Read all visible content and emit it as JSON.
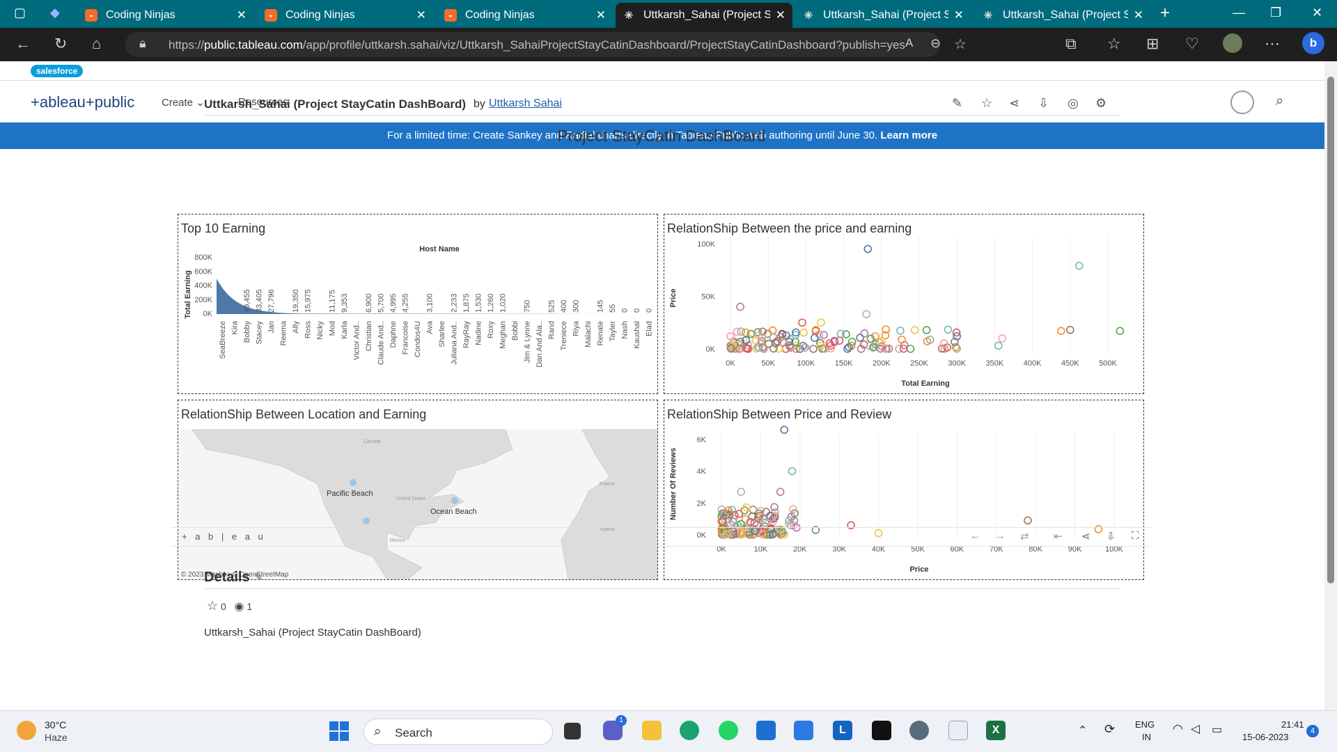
{
  "browser": {
    "tabs": [
      {
        "title": "Coding Ninjas",
        "icon": "coding-ninjas-icon",
        "active": false
      },
      {
        "title": "Coding Ninjas",
        "icon": "coding-ninjas-icon",
        "active": false
      },
      {
        "title": "Coding Ninjas",
        "icon": "coding-ninjas-icon",
        "active": false
      },
      {
        "title": "Uttkarsh_Sahai (Project Sta",
        "icon": "tableau-icon",
        "active": true
      },
      {
        "title": "Uttkarsh_Sahai (Project Sta",
        "icon": "tableau-icon",
        "active": false
      },
      {
        "title": "Uttkarsh_Sahai (Project Sta",
        "icon": "tableau-icon",
        "active": false
      }
    ],
    "url_prefix": "https://",
    "url_host": "public.tableau.com",
    "url_path": "/app/profile/uttkarsh.sahai/viz/Uttkarsh_SahaiProjectStayCatinDashboard/ProjectStayCatinDashboard?publish=yes"
  },
  "site": {
    "salesforce_label": "salesforce",
    "logo": "+ableau+public",
    "nav": {
      "create": "Create",
      "resources": "Resources"
    },
    "banner_text": "For a limited time: Create Sankey and Radial charts directly in Tableau Public web authoring until June 30.",
    "banner_link": "Learn more"
  },
  "viz": {
    "title": "Uttkarsh_Sahai (Project StayCatin DashBoard)",
    "by": "by",
    "author": "Uttkarsh Sahai",
    "dashboard_title": "Project StayCatin DashBoard",
    "wordmark": "+ a b | e a u"
  },
  "panels": {
    "top10": "Top 10 Earning",
    "price_earning": "RelationShip Between the price and earning",
    "location": "RelationShip Between Location and Earning",
    "price_review": "RelationShip Between Price and Review"
  },
  "map": {
    "labels": [
      "Pacific Beach",
      "Ocean Beach"
    ],
    "copyright": "© 2023 Mapbox  © OpenStreetMap",
    "faint": [
      "Canada",
      "United States",
      "Mexico",
      "France",
      "Algeria"
    ]
  },
  "chart_data": [
    {
      "type": "bar",
      "title": "Top 10 Earning",
      "xlabel": "Host Name",
      "ylabel": "Total Earning",
      "ylim": [
        0,
        800000
      ],
      "yticks": [
        "0K",
        "200K",
        "400K",
        "600K",
        "800K"
      ],
      "categories": [
        "SeaBreeze",
        "Kira",
        "Bobby",
        "Stacey",
        "Jan",
        "Reema",
        "Ally",
        "Ross",
        "Nicky",
        "Mod",
        "Karla",
        "Victor And..",
        "Christian",
        "Claude And..",
        "Daphne",
        "Francoise",
        "Condos4U",
        "Ava",
        "Sharlee",
        "Juliana And..",
        "RayRay",
        "Nadine",
        "Roxy",
        "Meghan",
        "Bobbi",
        "Jim & Lynne",
        "Dan And Ala..",
        "Rand",
        "Treniece",
        "Riya",
        "Malachi",
        "Renate",
        "Tayler",
        "Nash",
        "Kaushal",
        "Elad"
      ],
      "value_labels": [
        "",
        "",
        "49,455",
        "33,405",
        "27,796",
        "",
        "19,350",
        "15,975",
        "",
        "11,175",
        "9,353",
        "",
        "6,900",
        "5,700",
        "4,995",
        "4,255",
        "",
        "3,100",
        "",
        "2,233",
        "1,875",
        "1,530",
        "1,260",
        "1,020",
        "",
        "750",
        "",
        "525",
        "400",
        "300",
        "",
        "145",
        "55",
        "0",
        "0",
        "0"
      ]
    },
    {
      "type": "scatter",
      "title": "RelationShip Between the price and earning",
      "xlabel": "Total Earning",
      "ylabel": "Price",
      "xlim": [
        0,
        500000
      ],
      "ylim": [
        0,
        100000
      ],
      "xticks": [
        "0K",
        "50K",
        "100K",
        "150K",
        "200K",
        "250K",
        "300K",
        "350K",
        "400K",
        "450K",
        "500K"
      ],
      "yticks": [
        "0K",
        "50K",
        "100K"
      ],
      "points": [
        [
          182000,
          95000
        ],
        [
          462000,
          79000
        ],
        [
          13000,
          40000
        ],
        [
          180000,
          33000
        ],
        [
          95000,
          25000
        ],
        [
          120000,
          25000
        ],
        [
          450000,
          18000
        ],
        [
          438000,
          17000
        ],
        [
          516000,
          17000
        ],
        [
          360000,
          10000
        ],
        [
          300000,
          12000
        ],
        [
          355000,
          3000
        ]
      ]
    },
    {
      "type": "scatter",
      "title": "RelationShip Between Price and Review",
      "xlabel": "Price",
      "ylabel": "Number Of Reviews",
      "xlim": [
        0,
        100000
      ],
      "ylim": [
        0,
        6000
      ],
      "xticks": [
        "0K",
        "10K",
        "20K",
        "30K",
        "40K",
        "50K",
        "60K",
        "70K",
        "80K",
        "90K",
        "100K"
      ],
      "yticks": [
        "0K",
        "2K",
        "4K",
        "6K"
      ],
      "points": [
        [
          16000,
          6600
        ],
        [
          18000,
          4000
        ],
        [
          15000,
          2700
        ],
        [
          5000,
          2700
        ],
        [
          33000,
          600
        ],
        [
          40000,
          100
        ],
        [
          78000,
          900
        ],
        [
          96000,
          350
        ],
        [
          24000,
          300
        ],
        [
          10000,
          1500
        ]
      ]
    }
  ],
  "details": {
    "title": "Details",
    "favorites": "0",
    "views": "1",
    "name": "Uttkarsh_Sahai (Project StayCatin DashBoard)"
  },
  "taskbar": {
    "temp": "30°C",
    "condition": "Haze",
    "search": "Search",
    "lang1": "ENG",
    "lang2": "IN",
    "time": "21:41",
    "date": "15-06-2023",
    "notif_count": "4",
    "chat_badge": "1"
  },
  "colors": {
    "tab_bar": "#006b7d",
    "banner": "#1f73c6",
    "bar_fill": "#4e79a7"
  }
}
